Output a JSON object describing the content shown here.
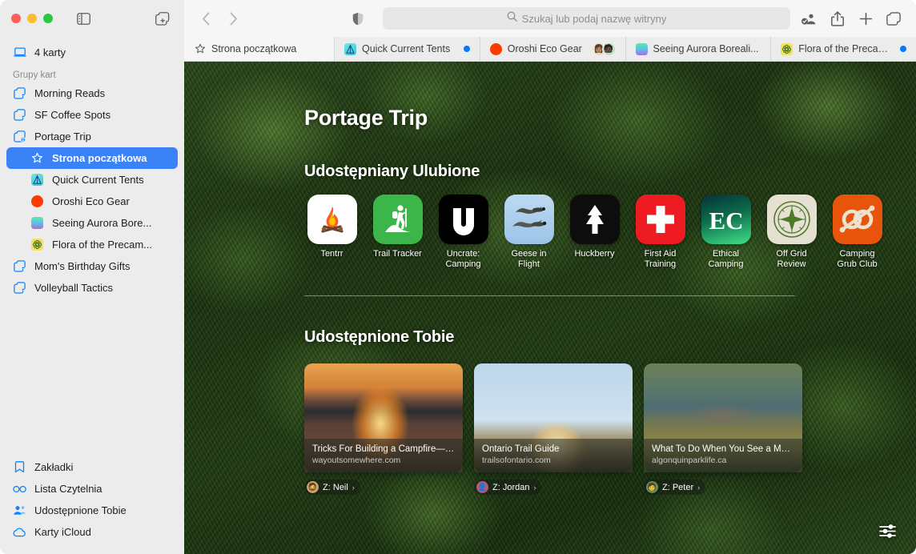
{
  "window": {
    "traffic_lights": [
      "close",
      "minimize",
      "zoom"
    ],
    "sidebar_toggle_icon": "sidebar-icon",
    "new_tab_group_icon": "new-tab-group-icon"
  },
  "sidebar": {
    "tabs_count_label": "4 karty",
    "tabs_count_icon": "laptop-icon",
    "group_header": "Grupy kart",
    "groups": [
      {
        "label": "Morning Reads",
        "icon": "tab-group-icon"
      },
      {
        "label": "SF Coffee Spots",
        "icon": "tab-group-icon"
      },
      {
        "label": "Portage Trip",
        "icon": "shared-tab-group-icon"
      }
    ],
    "portage_children": [
      {
        "label": "Strona początkowa",
        "icon": "star-icon",
        "selected": true,
        "fav": ""
      },
      {
        "label": "Quick Current Tents",
        "icon": "site-favicon",
        "selected": false,
        "fav": "tent"
      },
      {
        "label": "Oroshi Eco Gear",
        "icon": "site-favicon",
        "selected": false,
        "fav": "orange-circle"
      },
      {
        "label": "Seeing Aurora Bore...",
        "icon": "site-favicon",
        "selected": false,
        "fav": "aurora"
      },
      {
        "label": "Flora of the Precam...",
        "icon": "site-favicon",
        "selected": false,
        "fav": "flower"
      }
    ],
    "groups_after": [
      {
        "label": "Mom's Birthday Gifts",
        "icon": "tab-group-icon"
      },
      {
        "label": "Volleyball Tactics",
        "icon": "tab-group-icon"
      }
    ],
    "bottom_items": [
      {
        "label": "Zakładki",
        "icon": "bookmark-icon"
      },
      {
        "label": "Lista Czytelnia",
        "icon": "reading-list-icon"
      },
      {
        "label": "Udostępnione Tobie",
        "icon": "shared-with-you-icon"
      },
      {
        "label": "Karty iCloud",
        "icon": "icloud-icon"
      }
    ]
  },
  "toolbar": {
    "back_icon": "chevron-left-icon",
    "forward_icon": "chevron-right-icon",
    "shield_icon": "privacy-shield-icon",
    "search_placeholder": "Szukaj lub podaj nazwę witryny",
    "search_value": "",
    "search_icon": "search-icon",
    "right_icons": [
      {
        "name": "share-group-icon"
      },
      {
        "name": "share-icon"
      },
      {
        "name": "new-tab-plus-icon"
      },
      {
        "name": "tab-overview-icon"
      }
    ]
  },
  "tabs": [
    {
      "label": "Strona początkowa",
      "icon": "star-icon",
      "active": true,
      "badge": "",
      "avatars": []
    },
    {
      "label": "Quick Current Tents",
      "icon": "tent-favicon",
      "active": false,
      "badge": "blue-dot",
      "avatars": []
    },
    {
      "label": "Oroshi Eco Gear",
      "icon": "orange-circle-favicon",
      "active": false,
      "badge": "",
      "avatars": [
        "👩🏽",
        "🧑🏿"
      ]
    },
    {
      "label": "Seeing Aurora Boreali...",
      "icon": "aurora-favicon",
      "active": false,
      "badge": "",
      "avatars": []
    },
    {
      "label": "Flora of the Precambi...",
      "icon": "flower-favicon",
      "active": false,
      "badge": "blue-dot",
      "avatars": []
    }
  ],
  "start_page": {
    "title": "Portage Trip",
    "favorites_heading": "Udostępniany Ulubione",
    "favorites": [
      {
        "label": "Tentrr",
        "icon": "campfire-icon"
      },
      {
        "label": "Trail Tracker",
        "icon": "hiker-icon"
      },
      {
        "label": "Uncrate: Camping",
        "icon": "letter-u-icon"
      },
      {
        "label": "Geese in Flight",
        "icon": "geese-icon"
      },
      {
        "label": "Huckberry",
        "icon": "pine-tree-icon"
      },
      {
        "label": "First Aid Training",
        "icon": "red-cross-icon"
      },
      {
        "label": "Ethical Camping",
        "icon": "ec-monogram-icon"
      },
      {
        "label": "Off Grid Review",
        "icon": "compass-icon"
      },
      {
        "label": "Camping Grub Club",
        "icon": "cg-monogram-icon"
      }
    ],
    "shared_heading": "Udostępnione Tobie",
    "shared_cards": [
      {
        "title": "Tricks For Building a Campfire—F...",
        "site": "wayoutsomewhere.com",
        "image": "campfire-photo",
        "attribution": "Z: Neil",
        "avatar": "🧔"
      },
      {
        "title": "Ontario Trail Guide",
        "site": "trailsofontario.com",
        "image": "hiker-sunset-photo",
        "attribution": "Z: Jordan",
        "avatar": "👤"
      },
      {
        "title": "What To Do When You See a Moo...",
        "site": "algonquinparklife.ca",
        "image": "moose-photo",
        "attribution": "Z: Peter",
        "avatar": "🧑"
      }
    ],
    "settings_icon": "start-page-settings-icon"
  },
  "colors": {
    "accent": "#3b82f7",
    "sidebar_bg": "#ececec",
    "toolbar_bg": "#f6f6f6",
    "tab_badge": "#007aff"
  }
}
